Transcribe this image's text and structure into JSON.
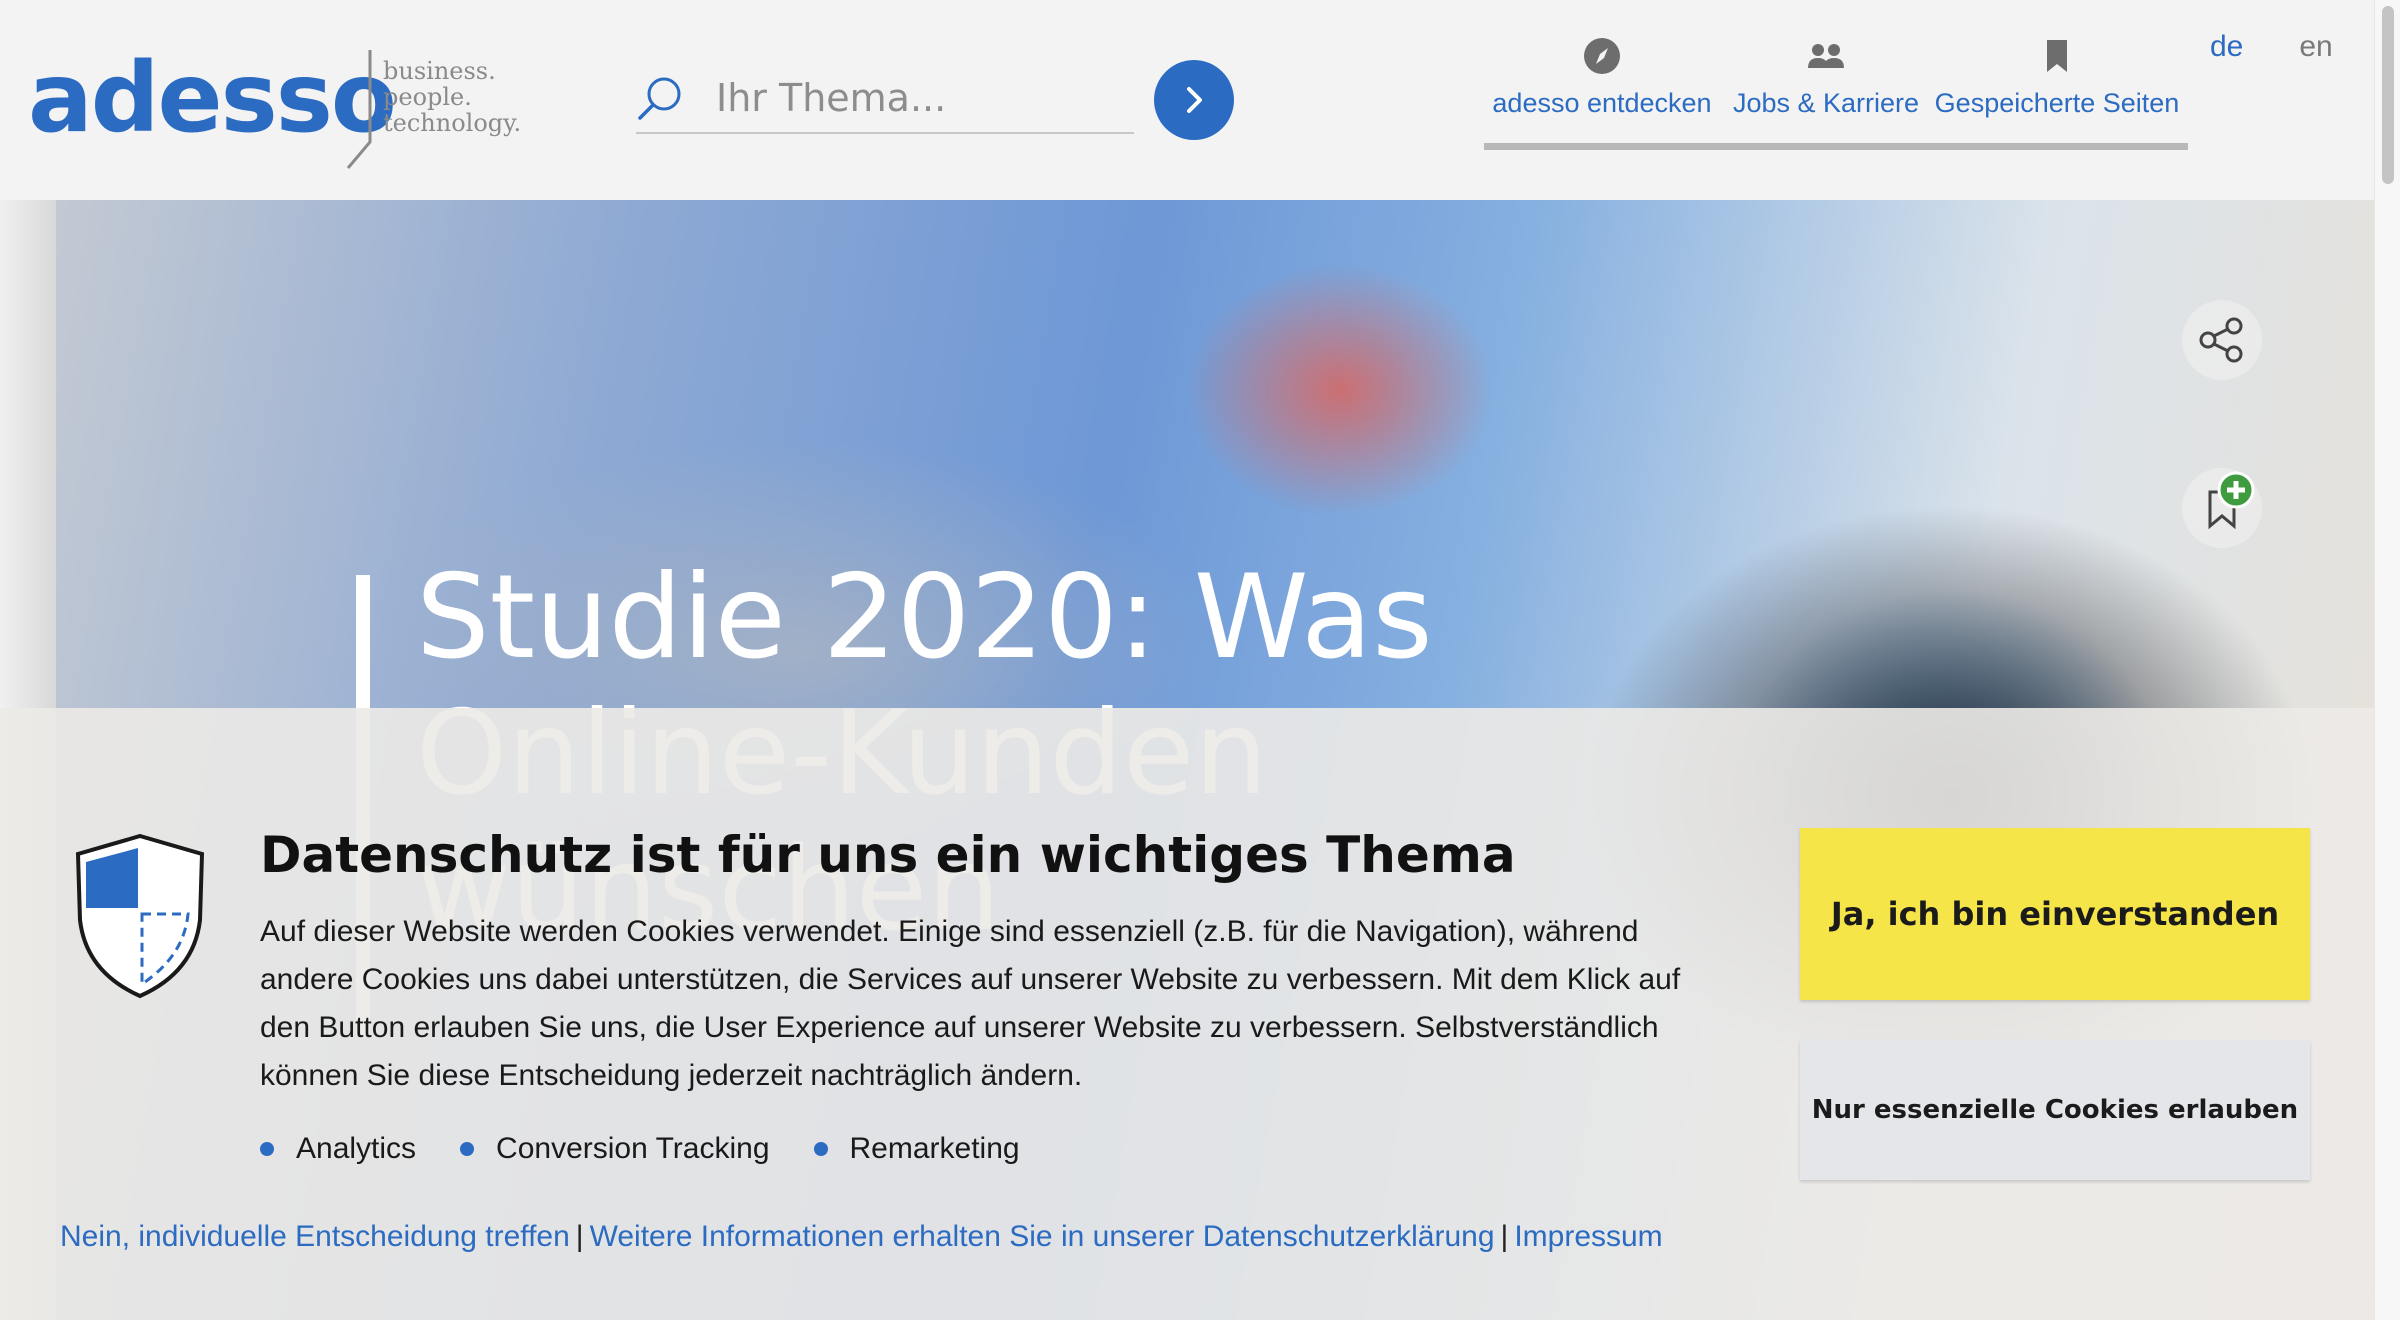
{
  "brand": {
    "name": "adesso",
    "tagline": [
      "business.",
      "people.",
      "technology."
    ],
    "color": "#2c6bc2"
  },
  "search": {
    "placeholder": "Ihr Thema..."
  },
  "nav": {
    "items": [
      {
        "label": "adesso entdecken",
        "icon": "compass-icon"
      },
      {
        "label": "Jobs & Karriere",
        "icon": "people-icon"
      },
      {
        "label": "Gespeicherte Seiten",
        "icon": "bookmark-icon"
      }
    ],
    "languages": [
      "de",
      "en"
    ],
    "active_language": "de"
  },
  "hero": {
    "title": "Studie 2020: Was Online-Kunden wünschen"
  },
  "cookie_banner": {
    "title": "Datenschutz ist für uns ein wichtiges Thema",
    "text": "Auf dieser Website werden Cookies verwendet. Einige sind essenziell (z.B. für die Navigation), während andere Cookies uns dabei unterstützen, die Services auf unserer Website zu verbessern. Mit dem Klick auf den Button erlauben Sie uns, die User Experience auf unserer Website zu verbessern. Selbstverständlich können Sie diese Entscheidung jederzeit nachträglich ändern.",
    "categories": [
      "Analytics",
      "Conversion Tracking",
      "Remarketing"
    ],
    "links": [
      "Nein, individuelle Entscheidung treffen",
      "Weitere Informationen erhalten Sie in unserer Datenschutzerklärung",
      "Impressum"
    ],
    "link_separator": "|",
    "accept_label": "Ja, ich bin einverstanden",
    "essential_label": "Nur essenzielle Cookies erlauben",
    "accept_color": "#f6e548"
  }
}
